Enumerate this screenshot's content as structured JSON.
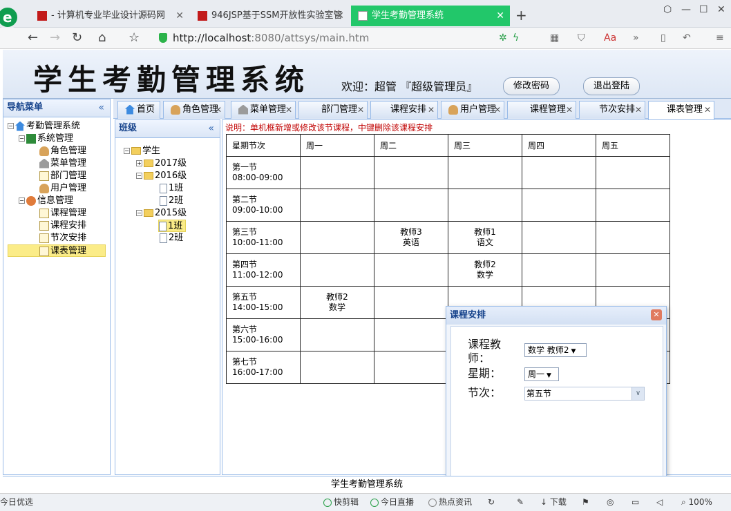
{
  "browser": {
    "tabs": [
      {
        "title": "- 计算机专业毕业设计源码网",
        "active": false
      },
      {
        "title": "946JSP基于SSM开放性实验室管",
        "active": false
      },
      {
        "title": "学生考勤管理系统",
        "active": true
      }
    ],
    "url_host": "http://localhost",
    "url_rest": ":8080/attsys/main.htm"
  },
  "header": {
    "title": "学生考勤管理系统",
    "welcome": "欢迎：超管 『超级管理员』",
    "change_password": "修改密码",
    "logout": "退出登陆"
  },
  "leftnav": {
    "title": "导航菜单",
    "collapse": "«",
    "root": "考勤管理系统",
    "group1": "系统管理",
    "group1_items": [
      "角色管理",
      "菜单管理",
      "部门管理",
      "用户管理"
    ],
    "group2": "信息管理",
    "group2_items": [
      "课程管理",
      "课程安排",
      "节次安排",
      "课表管理"
    ]
  },
  "tabs": [
    "首页",
    "角色管理",
    "菜单管理",
    "部门管理",
    "课程安排",
    "用户管理",
    "课程管理",
    "节次安排",
    "课表管理"
  ],
  "classpanel": {
    "title": "班级",
    "collapse": "«",
    "root": "学生",
    "grades": [
      "2017级",
      "2016级",
      "2015级"
    ],
    "g2016_classes": [
      "1班",
      "2班"
    ],
    "g2015_classes": [
      "1班",
      "2班"
    ]
  },
  "schedule": {
    "note": "说明：单机框新增或修改该节课程，中键删除该课程安排",
    "headers": [
      "星期节次",
      "周一",
      "周二",
      "周三",
      "周四",
      "周五"
    ],
    "rows": [
      {
        "name": "第一节",
        "time": "08:00-09:00",
        "cells": [
          "",
          "",
          "",
          "",
          ""
        ]
      },
      {
        "name": "第二节",
        "time": "09:00-10:00",
        "cells": [
          "",
          "",
          "",
          "",
          ""
        ]
      },
      {
        "name": "第三节",
        "time": "10:00-11:00",
        "cells": [
          "",
          "教师3\n英语",
          "教师1\n语文",
          "",
          ""
        ]
      },
      {
        "name": "第四节",
        "time": "11:00-12:00",
        "cells": [
          "",
          "",
          "教师2\n数学",
          "",
          ""
        ]
      },
      {
        "name": "第五节",
        "time": "14:00-15:00",
        "cells": [
          "教师2\n数学",
          "",
          "",
          "",
          ""
        ]
      },
      {
        "name": "第六节",
        "time": "15:00-16:00",
        "cells": [
          "",
          "",
          "",
          "",
          ""
        ]
      },
      {
        "name": "第七节",
        "time": "16:00-17:00",
        "cells": [
          "",
          "",
          "",
          "",
          ""
        ]
      }
    ]
  },
  "dialog": {
    "title": "课程安排",
    "close": "✕",
    "teacher_label": "课程教\n师：",
    "teacher_value": "数学 教师2",
    "weekday_label": "星期：",
    "weekday_value": "周一",
    "period_label": "节次：",
    "period_value": "第五节"
  },
  "footer": "学生考勤管理系统",
  "statusbar": {
    "left": "今日优选",
    "items": [
      "快剪辑",
      "今日直播",
      "热点资讯",
      "下载",
      "100%"
    ]
  }
}
